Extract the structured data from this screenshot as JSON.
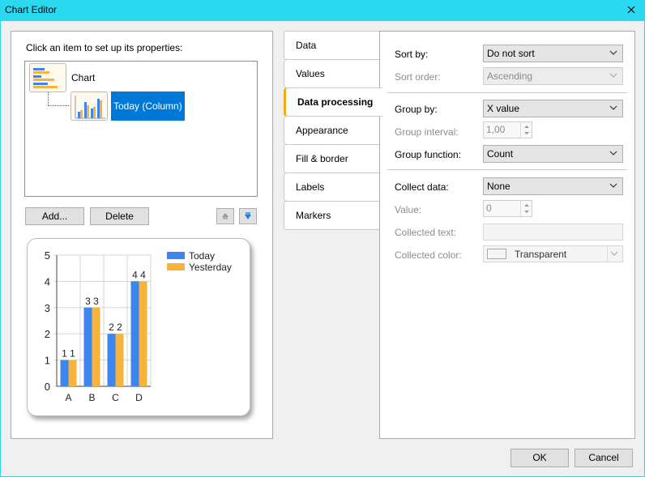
{
  "window": {
    "title": "Chart Editor"
  },
  "left": {
    "hint": "Click an item to set up its properties:",
    "tree": {
      "root": "Chart",
      "child": "Today (Column)"
    },
    "buttons": {
      "add": "Add...",
      "delete": "Delete"
    }
  },
  "chart_data": {
    "type": "bar",
    "categories": [
      "A",
      "B",
      "C",
      "D"
    ],
    "series": [
      {
        "name": "Today",
        "values": [
          1,
          3,
          2,
          4
        ],
        "color": "#3d86f0"
      },
      {
        "name": "Yesterday",
        "values": [
          1,
          3,
          2,
          4
        ],
        "color": "#f7b33b"
      }
    ],
    "ylim": [
      0,
      5
    ],
    "yticks": [
      "0",
      "1",
      "2",
      "3",
      "4",
      "5"
    ],
    "grid": true,
    "legend": "top-right",
    "data_labels": true
  },
  "tabs": [
    {
      "label": "Data",
      "active": false
    },
    {
      "label": "Values",
      "active": false
    },
    {
      "label": "Data processing",
      "active": true
    },
    {
      "label": "Appearance",
      "active": false
    },
    {
      "label": "Fill & border",
      "active": false
    },
    {
      "label": "Labels",
      "active": false
    },
    {
      "label": "Markers",
      "active": false
    }
  ],
  "props": {
    "sort_by": {
      "label": "Sort by:",
      "value": "Do not sort"
    },
    "sort_order": {
      "label": "Sort order:",
      "value": "Ascending"
    },
    "group_by": {
      "label": "Group by:",
      "value": "X value"
    },
    "group_interval": {
      "label": "Group interval:",
      "value": "1,00"
    },
    "group_function": {
      "label": "Group function:",
      "value": "Count"
    },
    "collect_data": {
      "label": "Collect data:",
      "value": "None"
    },
    "value": {
      "label": "Value:",
      "value": "0"
    },
    "collected_text": {
      "label": "Collected text:",
      "value": ""
    },
    "collected_color": {
      "label": "Collected color:",
      "value": "Transparent"
    }
  },
  "footer": {
    "ok": "OK",
    "cancel": "Cancel"
  }
}
